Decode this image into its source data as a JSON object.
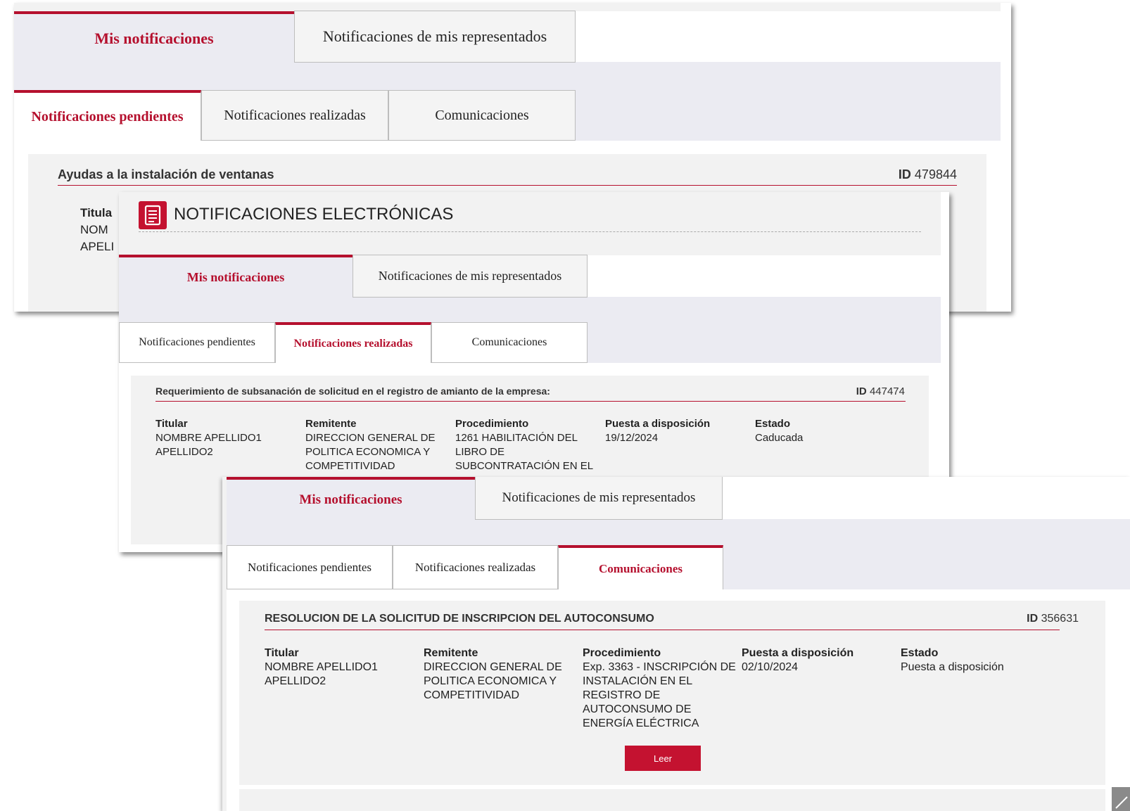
{
  "screen1": {
    "tabs_top": [
      "Mis notificaciones",
      "Notificaciones de mis representados"
    ],
    "tabs_sub": [
      "Notificaciones pendientes",
      "Notificaciones realizadas",
      "Comunicaciones"
    ],
    "card": {
      "title": "Ayudas a la instalación de ventanas",
      "id_label": "ID",
      "id_value": "479844",
      "titular_label": "Titula",
      "titular_line1": "NOM",
      "titular_line2": "APELI"
    }
  },
  "screen2": {
    "header_title": "NOTIFICACIONES ELECTRÓNICAS",
    "header_icon": "document-list-icon",
    "tabs_top": [
      "Mis notificaciones",
      "Notificaciones de mis representados"
    ],
    "tabs_sub": [
      "Notificaciones pendientes",
      "Notificaciones realizadas",
      "Comunicaciones"
    ],
    "card": {
      "title": "Requerimiento de subsanación de solicitud en el registro de amianto de la empresa:",
      "id_label": "ID",
      "id_value": "447474",
      "columns": [
        {
          "label": "Titular",
          "value": "NOMBRE APELLIDO1\nAPELLIDO2"
        },
        {
          "label": "Remitente",
          "value": "DIRECCION GENERAL DE\nPOLITICA ECONOMICA Y\nCOMPETITIVIDAD"
        },
        {
          "label": "Procedimiento",
          "value": "1261 HABILITACIÓN DEL\nLIBRO DE\nSUBCONTRATACIÓN EN EL"
        },
        {
          "label": "Puesta a disposición",
          "value": "19/12/2024"
        },
        {
          "label": "Estado",
          "value": "Caducada"
        }
      ]
    }
  },
  "screen3": {
    "tabs_top": [
      "Mis notificaciones",
      "Notificaciones de mis representados"
    ],
    "tabs_sub": [
      "Notificaciones pendientes",
      "Notificaciones realizadas",
      "Comunicaciones"
    ],
    "card": {
      "title": "RESOLUCION DE LA SOLICITUD DE INSCRIPCION DEL AUTOCONSUMO",
      "id_label": "ID",
      "id_value": "356631",
      "columns": [
        {
          "label": "Titular",
          "value": "NOMBRE APELLIDO1\nAPELLIDO2"
        },
        {
          "label": "Remitente",
          "value": "DIRECCION GENERAL DE\nPOLITICA ECONOMICA Y\nCOMPETITIVIDAD"
        },
        {
          "label": "Procedimiento",
          "value": "Exp. 3363 - INSCRIPCIÓN DE\nINSTALACIÓN EN EL\nREGISTRO DE\nAUTOCONSUMO DE\nENERGÍA ELÉCTRICA"
        },
        {
          "label": "Puesta a disposición",
          "value": "02/10/2024"
        },
        {
          "label": "Estado",
          "value": "Puesta a disposición"
        }
      ],
      "button_label": "Leer"
    }
  },
  "colors": {
    "accent": "#b5102e",
    "button": "#c41230",
    "band": "#ebebf2",
    "card": "#f2f2f2"
  }
}
